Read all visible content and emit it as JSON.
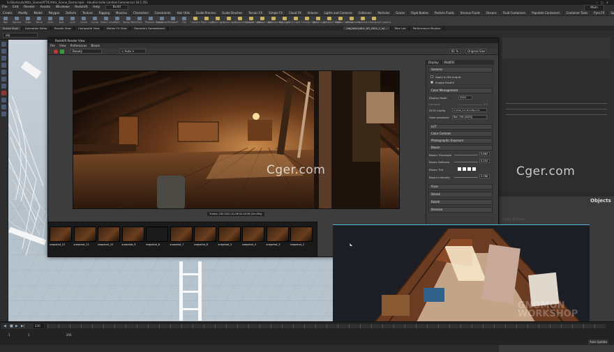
{
  "app": {
    "title": "S:/Shortcuts/Attic_Scene/ATTIC/Attic_Scene_Demo.hiplc - Houdini Indie Limited-Commercial 18.5.351",
    "menu": [
      "File",
      "Edit",
      "Render",
      "Assets",
      "Windows",
      "Redshift",
      "Help"
    ],
    "build": "Build",
    "desktop": "Main"
  },
  "shelf_tabs": [
    "Create",
    "Modify",
    "Model",
    "Polygon",
    "Deform",
    "Texture",
    "Rigging",
    "Muscles",
    "Characters",
    "Constraints",
    "Hair Utils",
    "Guide Process",
    "Guide Brushes",
    "Terrain FX",
    "Simple FX",
    "Cloud FX",
    "Volume",
    "Lights and Cameras",
    "Collisions",
    "Particles",
    "Grains",
    "Rigid Bodies",
    "Particle Fluids",
    "Viscous Fluids",
    "Oceans",
    "Fluid Containers",
    "Populate Containers",
    "Container Tools",
    "Pyro FX",
    "Sparse Pyro FX",
    "FEM",
    "Wires",
    "Crowds",
    "Drive Simulation",
    "Redshift"
  ],
  "shelf_tools": [
    "Box",
    "Sphere",
    "Tube",
    "Torus",
    "Grid",
    "Null",
    "Line",
    "Circle",
    "Curve",
    "Draw Curve",
    "Path",
    "Spray Paint",
    "Font",
    "Platonic Solids",
    "L-System",
    "Metaball",
    "File",
    "Camera",
    "Point Light",
    "Spot Light",
    "Area Light",
    "Geometry Light",
    "Volume Light",
    "Distant Light",
    "Environment Light",
    "Sky Light",
    "GI Light",
    "Caustic Light",
    "Portal Light",
    "Ambient Light",
    "Stereo Camera",
    "VR Camera",
    "Switcher",
    "Gamepad Camera"
  ],
  "pane_tabs": [
    "Scene View",
    "Animation Editor",
    "Render View",
    "Composite View",
    "Motion FX View",
    "Geometry Spreadsheet"
  ],
  "pane_tabs_right": [
    "/obj/attic/attic_AO_Attic_1_w/...",
    "Take List",
    "Performance Monitor"
  ],
  "path": "obj",
  "viewport": {
    "menu": "Persp",
    "cam": "No cam"
  },
  "render_view": {
    "title": "Redshift Render View",
    "menu": [
      "File",
      "View",
      "Preferences",
      "Bloom"
    ],
    "aov": "Beauty",
    "auto": "< Auto >",
    "zoom": "81 %",
    "size": "Original Size",
    "frame_caption": "Frame: 230 2021-01-06 02:40:38 (2m:59s)",
    "tabs": [
      "Display",
      "PostFX"
    ],
    "general": "General",
    "apply_to_file": "Apply to file output",
    "enable_postfx": "Enable PostFX",
    "color_management": "Color Management",
    "display_mode_label": "Display Mode",
    "display_mode": "OCIO",
    "gamma_label": "Gamma",
    "gamma": "2.2",
    "ocio_label": "OCIO Config",
    "ocio": "C:/aces_1.0.3/config.ocio",
    "view_transform_label": "View transform",
    "view_transform": "Rec.709 (ACES)",
    "sections": [
      "LUT",
      "Color Controls",
      "Photographic Exposure",
      "Bloom"
    ],
    "bloom_threshold_label": "Bloom Threshold",
    "bloom_threshold": "5.663",
    "bloom_softness_label": "Bloom Softness",
    "bloom_softness": "0.254",
    "bloom_tint_label": "Bloom Tint",
    "bloom_intensity_label": "Bloom Intensity",
    "bloom_intensity": "5.766",
    "more_sections": [
      "Flare",
      "Streak",
      "Bokeh",
      "Denoise"
    ]
  },
  "snapshots": [
    "snapshot_12",
    "snapshot_11",
    "snapshot_10",
    "snapshot_9",
    "snapshot_8",
    "snapshot_7",
    "snapshot_6",
    "snapshot_5",
    "snapshot_4",
    "snapshot_3",
    "snapshot_2"
  ],
  "timeline": {
    "frame": "230",
    "start": "1",
    "start2": "1",
    "end": "241"
  },
  "right": {
    "objects": "Objects",
    "label": "Indie Edition"
  },
  "status": "Auto Update",
  "watermark": "Cger.com",
  "watermark2": "Cger.com",
  "logo": "GNOMON WORKSHOP",
  "colors": {
    "accent": "#56b8d9",
    "render_warm": "#b86a2a"
  }
}
